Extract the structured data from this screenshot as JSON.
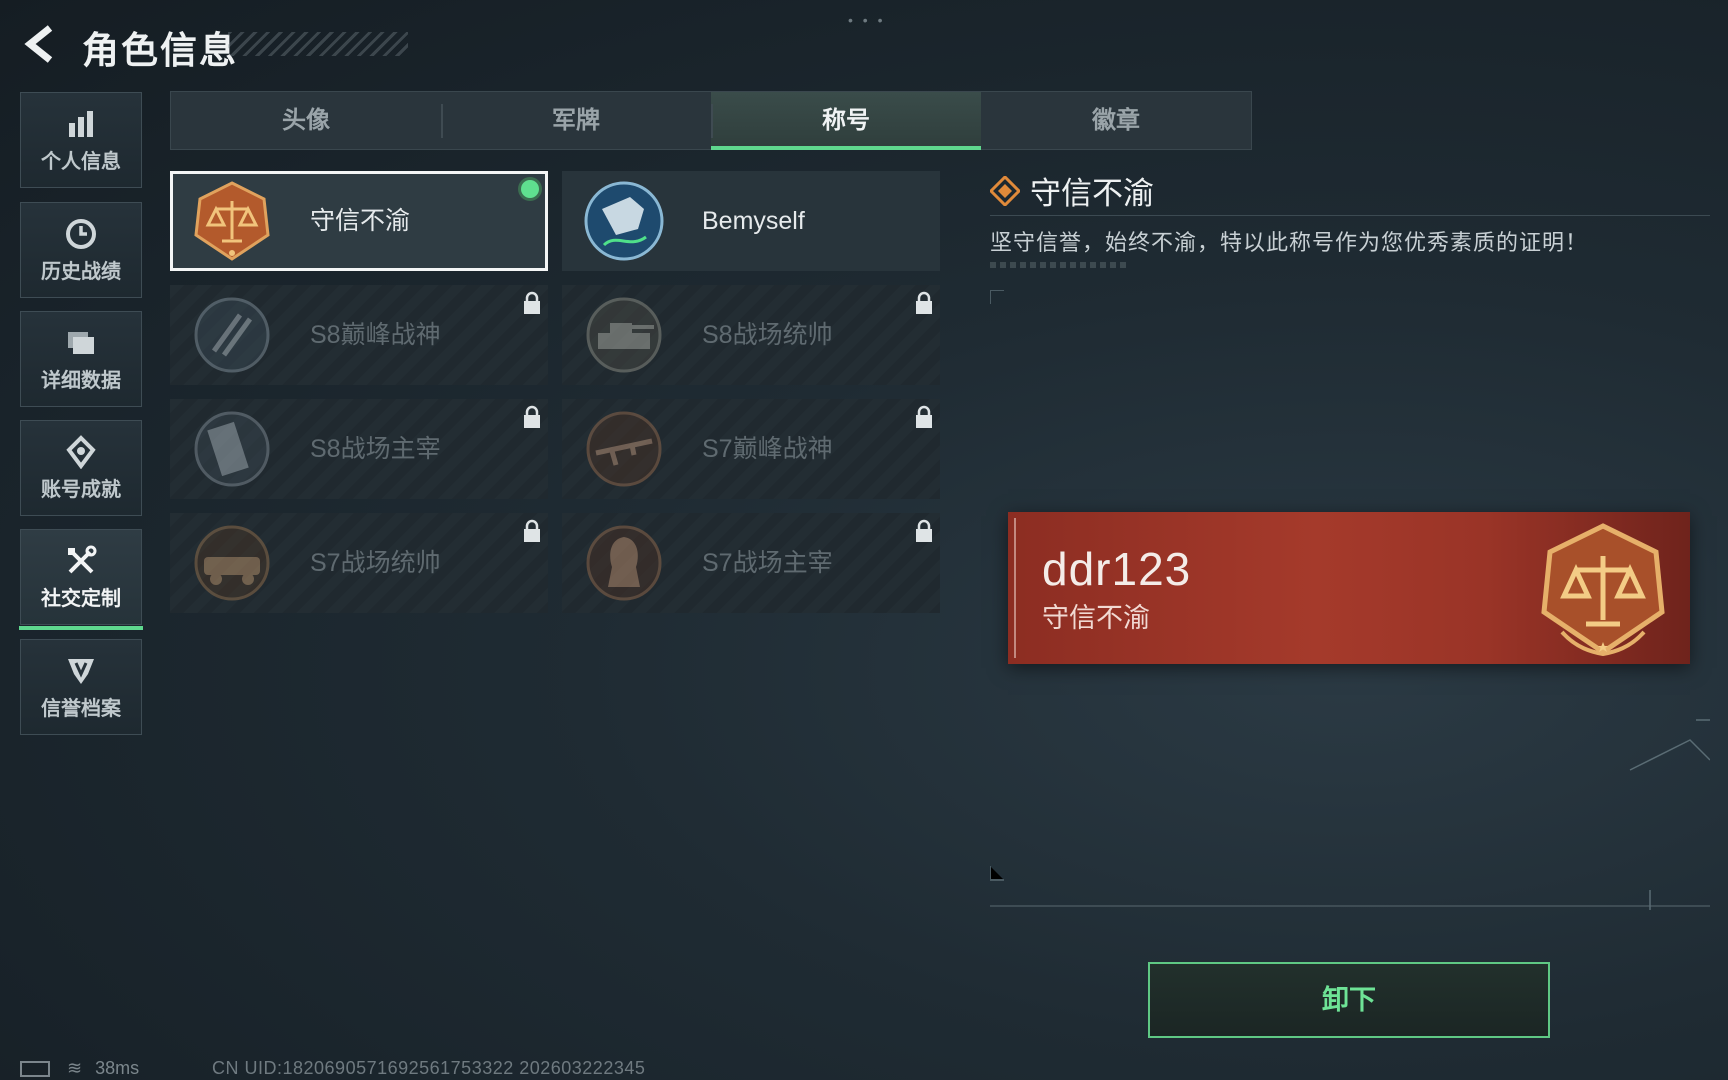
{
  "header": {
    "title": "角色信息"
  },
  "sidebar": {
    "items": [
      {
        "label": "个人信息",
        "icon": "bar-chart-icon"
      },
      {
        "label": "历史战绩",
        "icon": "history-icon"
      },
      {
        "label": "详细数据",
        "icon": "folder-icon"
      },
      {
        "label": "账号成就",
        "icon": "achievement-icon"
      },
      {
        "label": "社交定制",
        "icon": "tools-icon",
        "active": true
      },
      {
        "label": "信誉档案",
        "icon": "shield-emblem-icon"
      }
    ]
  },
  "tabs": [
    {
      "label": "头像"
    },
    {
      "label": "军牌"
    },
    {
      "label": "称号",
      "active": true
    },
    {
      "label": "徽章"
    }
  ],
  "titles": [
    {
      "name": "守信不渝",
      "state": "equipped"
    },
    {
      "name": "Bemyself",
      "state": "unlocked"
    },
    {
      "name": "S8巅峰战神",
      "state": "locked"
    },
    {
      "name": "S8战场统帅",
      "state": "locked"
    },
    {
      "name": "S8战场主宰",
      "state": "locked"
    },
    {
      "name": "S7巅峰战神",
      "state": "locked"
    },
    {
      "name": "S7战场统帅",
      "state": "locked"
    },
    {
      "name": "S7战场主宰",
      "state": "locked"
    }
  ],
  "detail": {
    "title": "守信不渝",
    "description": "坚守信誉，始终不渝，特以此称号作为您优秀素质的证明！",
    "preview": {
      "username": "ddr123",
      "title": "守信不渝"
    },
    "action_label": "卸下"
  },
  "status": {
    "ping": "38ms",
    "uid": "CN UID:1820690571692561753322 202603222345"
  },
  "colors": {
    "accent": "#5fd88e",
    "banner": "#a53a2b",
    "medal_gold": "#d9a25a"
  }
}
